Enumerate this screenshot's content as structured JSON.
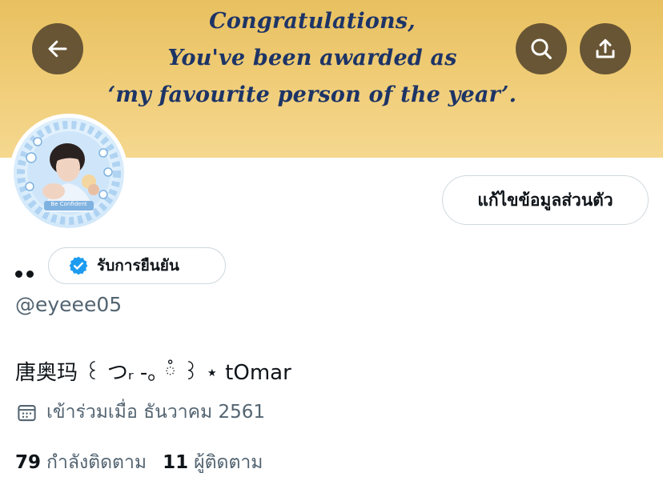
{
  "banner": {
    "lines": [
      "Congratulations,",
      "You've been awarded as",
      "‘my favourite person of the year’."
    ]
  },
  "nav": {
    "back_icon": "arrow-left-icon",
    "search_icon": "search-icon",
    "share_icon": "share-upload-icon"
  },
  "avatar": {
    "caption": "Be Confident"
  },
  "profile": {
    "edit_label": "แก้ไขข้อมูลส่วนตัว",
    "display_name": "••",
    "verify_label": "รับการยืนยัน",
    "handle": "@eyeee05",
    "bio": "唐奥玛 ꒰ つᵣ -｡ ཾ ꒱ ⋆ tOmar",
    "joined": "เข้าร่วมเมื่อ ธันวาคม 2561"
  },
  "stats": {
    "following_count": "79",
    "following_label": "กำลังติดตาม",
    "followers_count": "11",
    "followers_label": "ผู้ติดตาม"
  },
  "colors": {
    "accent": "#1d9bf0",
    "banner_text": "#1d3466",
    "secondary_text": "#536471"
  }
}
